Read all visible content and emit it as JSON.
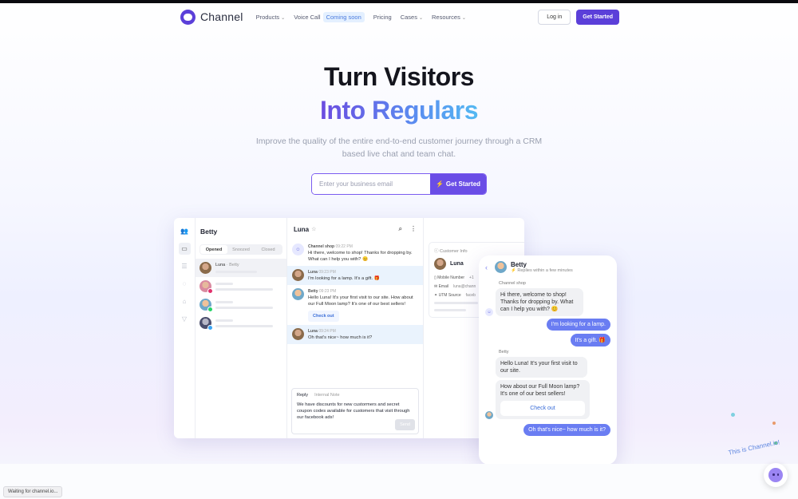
{
  "nav": {
    "brand": "Channel",
    "items": [
      {
        "label": "Products",
        "dropdown": true
      },
      {
        "label": "Voice Call",
        "badge": "Coming soon"
      },
      {
        "label": "Pricing"
      },
      {
        "label": "Cases",
        "dropdown": true
      },
      {
        "label": "Resources",
        "dropdown": true
      }
    ],
    "login": "Log in",
    "get_started": "Get Started"
  },
  "hero": {
    "line1": "Turn Visitors",
    "line2": "Into Regulars",
    "subtitle": "Improve the quality of the entire end-to-end customer journey through a CRM based live chat and team chat.",
    "email_placeholder": "Enter your business email",
    "cta": "Get Started"
  },
  "app": {
    "inbox_title": "Betty",
    "tabs": [
      "Opened",
      "Snoozed",
      "Closed"
    ],
    "first_conversation": {
      "name": "Luna",
      "assignee": "· Betty"
    },
    "chat_title": "Luna",
    "messages": [
      {
        "sender": "Channel shop",
        "time": "09:22 PM",
        "text": "Hi there, welcome to shop! Thanks for dropping by. What can I help you with? 😊"
      },
      {
        "sender": "Luna",
        "time": "09:23 PM",
        "text": "I'm looking for a lamp. It's a gift. 🎁"
      },
      {
        "sender": "Betty",
        "time": "09:23 PM",
        "text": "Hello Luna! It's your first visit to our site. How about our Full Moon lamp? It's one of our best sellers!",
        "button": "Check out"
      },
      {
        "sender": "Luna",
        "time": "09:24 PM",
        "text": "Oh that's nice~ how much is it?"
      }
    ],
    "reply_tab": "Reply",
    "note_tab": "Internal Note",
    "reply_text": "We have discounts for new custormers and secret coupon codes available for customers that visit through our facebook ads!",
    "send": "Send",
    "customer_info": {
      "title": "Customer Info",
      "name": "Luna",
      "mobile_label": "Mobile Number",
      "mobile_value": "+1",
      "email_label": "Email",
      "email_value": "luna@chann",
      "utm_label": "UTM Source",
      "utm_value": "faceb"
    }
  },
  "phone": {
    "agent": "Betty",
    "status": "Replies within a few minutes",
    "shop_label": "Channel shop",
    "shop_msg": "Hi there, welcome to shop! Thanks for dropping by. What can I help you with? 😊",
    "user1": "I'm looking for a lamp.",
    "user2": "It's a gift. 🎁",
    "agent_label": "Betty",
    "agent_msg1": "Hello Luna! It's your first visit to our site.",
    "agent_msg2": "How about our Full Moon lamp? It's one of our best sellers!",
    "checkout": "Check out",
    "user3": "Oh that's nice~ how much is it?"
  },
  "hint": "This is Channel.io!",
  "status_bar": "Waiting for channel.io...",
  "colors": {
    "brand": "#5b3fd9",
    "gradient_start": "#6b4be0",
    "gradient_end": "#53b9f2",
    "outgoing": "#6a7df2"
  }
}
